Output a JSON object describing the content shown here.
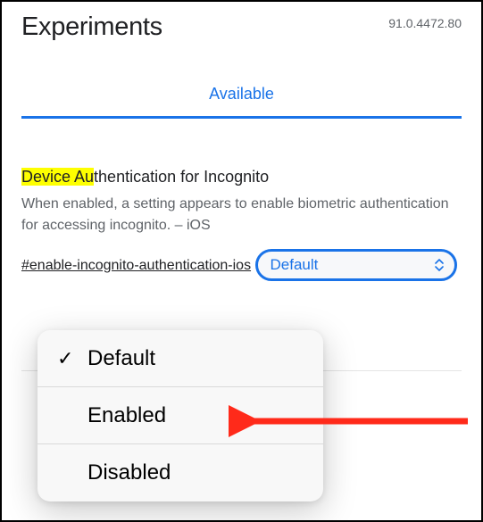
{
  "header": {
    "title": "Experiments",
    "version": "91.0.4472.80"
  },
  "tabs": {
    "available": "Available"
  },
  "flag": {
    "title_highlighted": "Device Au",
    "title_rest": "thentication for Incognito",
    "description": "When enabled, a setting appears to enable biometric authentication for accessing incognito. – iOS",
    "hash": "#enable-incognito-authentication-ios"
  },
  "select": {
    "value": "Default"
  },
  "dropdown": {
    "items": [
      {
        "label": "Default",
        "checked": true
      },
      {
        "label": "Enabled",
        "checked": false
      },
      {
        "label": "Disabled",
        "checked": false
      }
    ]
  }
}
